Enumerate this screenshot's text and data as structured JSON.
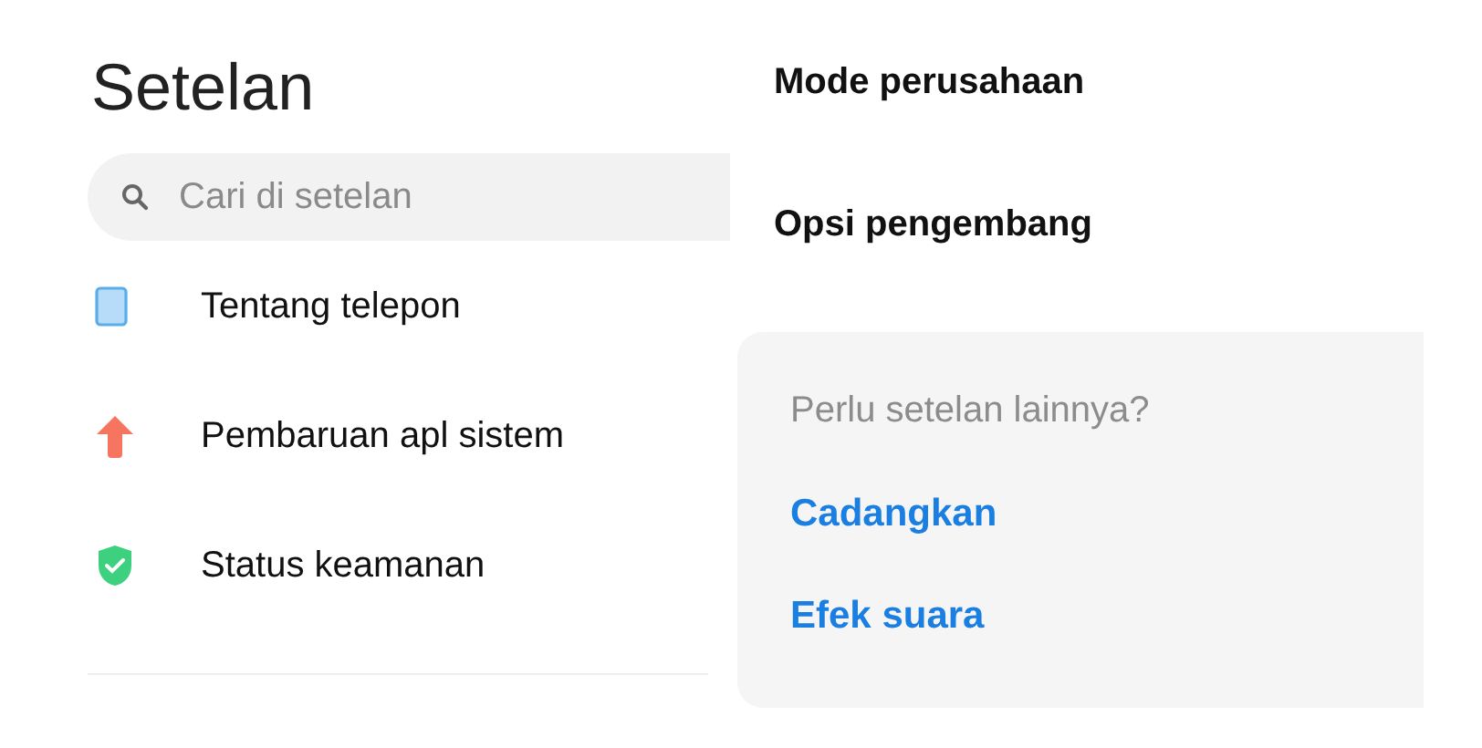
{
  "title": "Setelan",
  "search": {
    "placeholder": "Cari di setelan"
  },
  "items": [
    {
      "label": "Tentang telepon",
      "kind": "phone"
    },
    {
      "label": "Pembaruan apl sistem",
      "kind": "update"
    },
    {
      "label": "Status keamanan",
      "kind": "security"
    }
  ],
  "more_items": [
    {
      "label": "Mode perusahaan"
    },
    {
      "label": "Opsi pengembang"
    }
  ],
  "suggestions": {
    "heading": "Perlu setelan lainnya?",
    "links": [
      "Cadangkan",
      "Efek suara"
    ]
  }
}
